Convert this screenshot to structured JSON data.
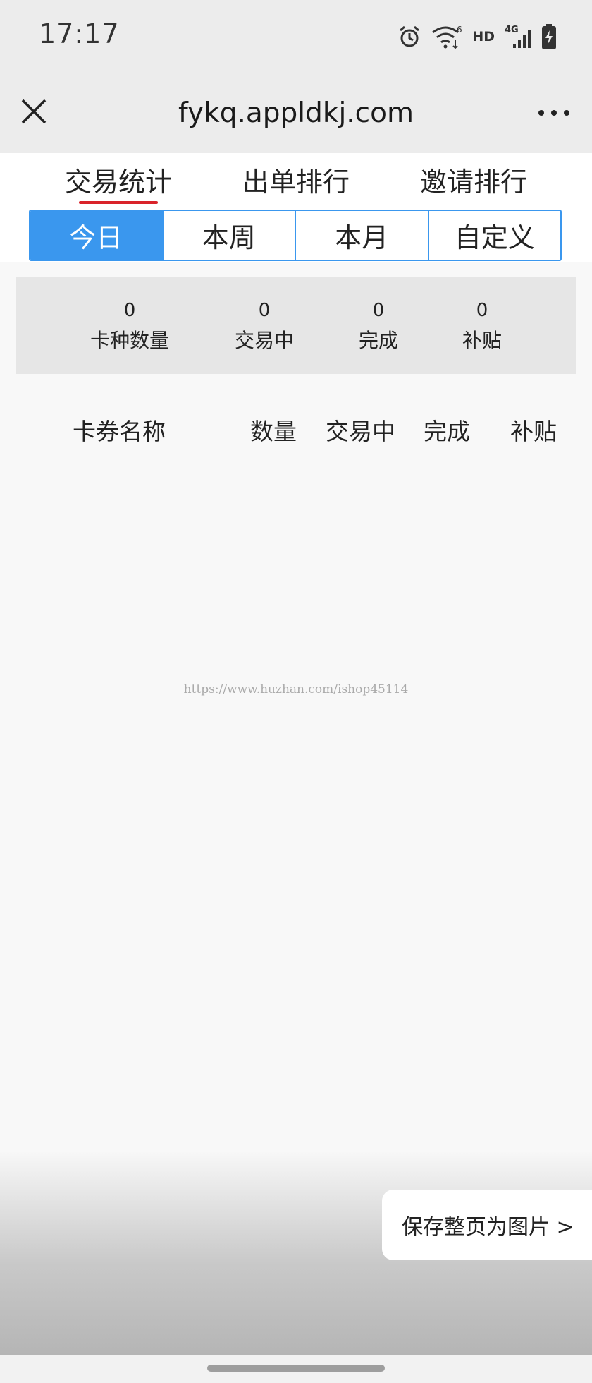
{
  "status_bar": {
    "time": "17:17",
    "hd_label": "HD",
    "network_label": "4G",
    "wifi_badge": "6",
    "icons": [
      "alarm-icon",
      "wifi-icon",
      "signal-icon",
      "battery-charging-icon"
    ]
  },
  "nav": {
    "title": "fykq.appldkj.com",
    "close_icon": "close-icon",
    "more_icon": "more-icon"
  },
  "tabs": [
    {
      "label": "交易统计",
      "active": true
    },
    {
      "label": "出单排行",
      "active": false
    },
    {
      "label": "邀请排行",
      "active": false
    }
  ],
  "period_filter": [
    {
      "label": "今日",
      "active": true
    },
    {
      "label": "本周",
      "active": false
    },
    {
      "label": "本月",
      "active": false
    },
    {
      "label": "自定义",
      "active": false
    }
  ],
  "summary": [
    {
      "value": "0",
      "label": "卡种数量"
    },
    {
      "value": "0",
      "label": "交易中"
    },
    {
      "value": "0",
      "label": "完成"
    },
    {
      "value": "0",
      "label": "补贴"
    }
  ],
  "table": {
    "columns": [
      "卡券名称",
      "数量",
      "交易中",
      "完成",
      "补贴"
    ],
    "rows": []
  },
  "watermark": "https://www.huzhan.com/ishop45114",
  "save_button": "保存整页为图片 >",
  "colors": {
    "accent_blue": "#3a97ee",
    "tab_underline_red": "#d9232a",
    "summary_bg": "#e6e6e6",
    "nav_bg": "#ececec"
  }
}
